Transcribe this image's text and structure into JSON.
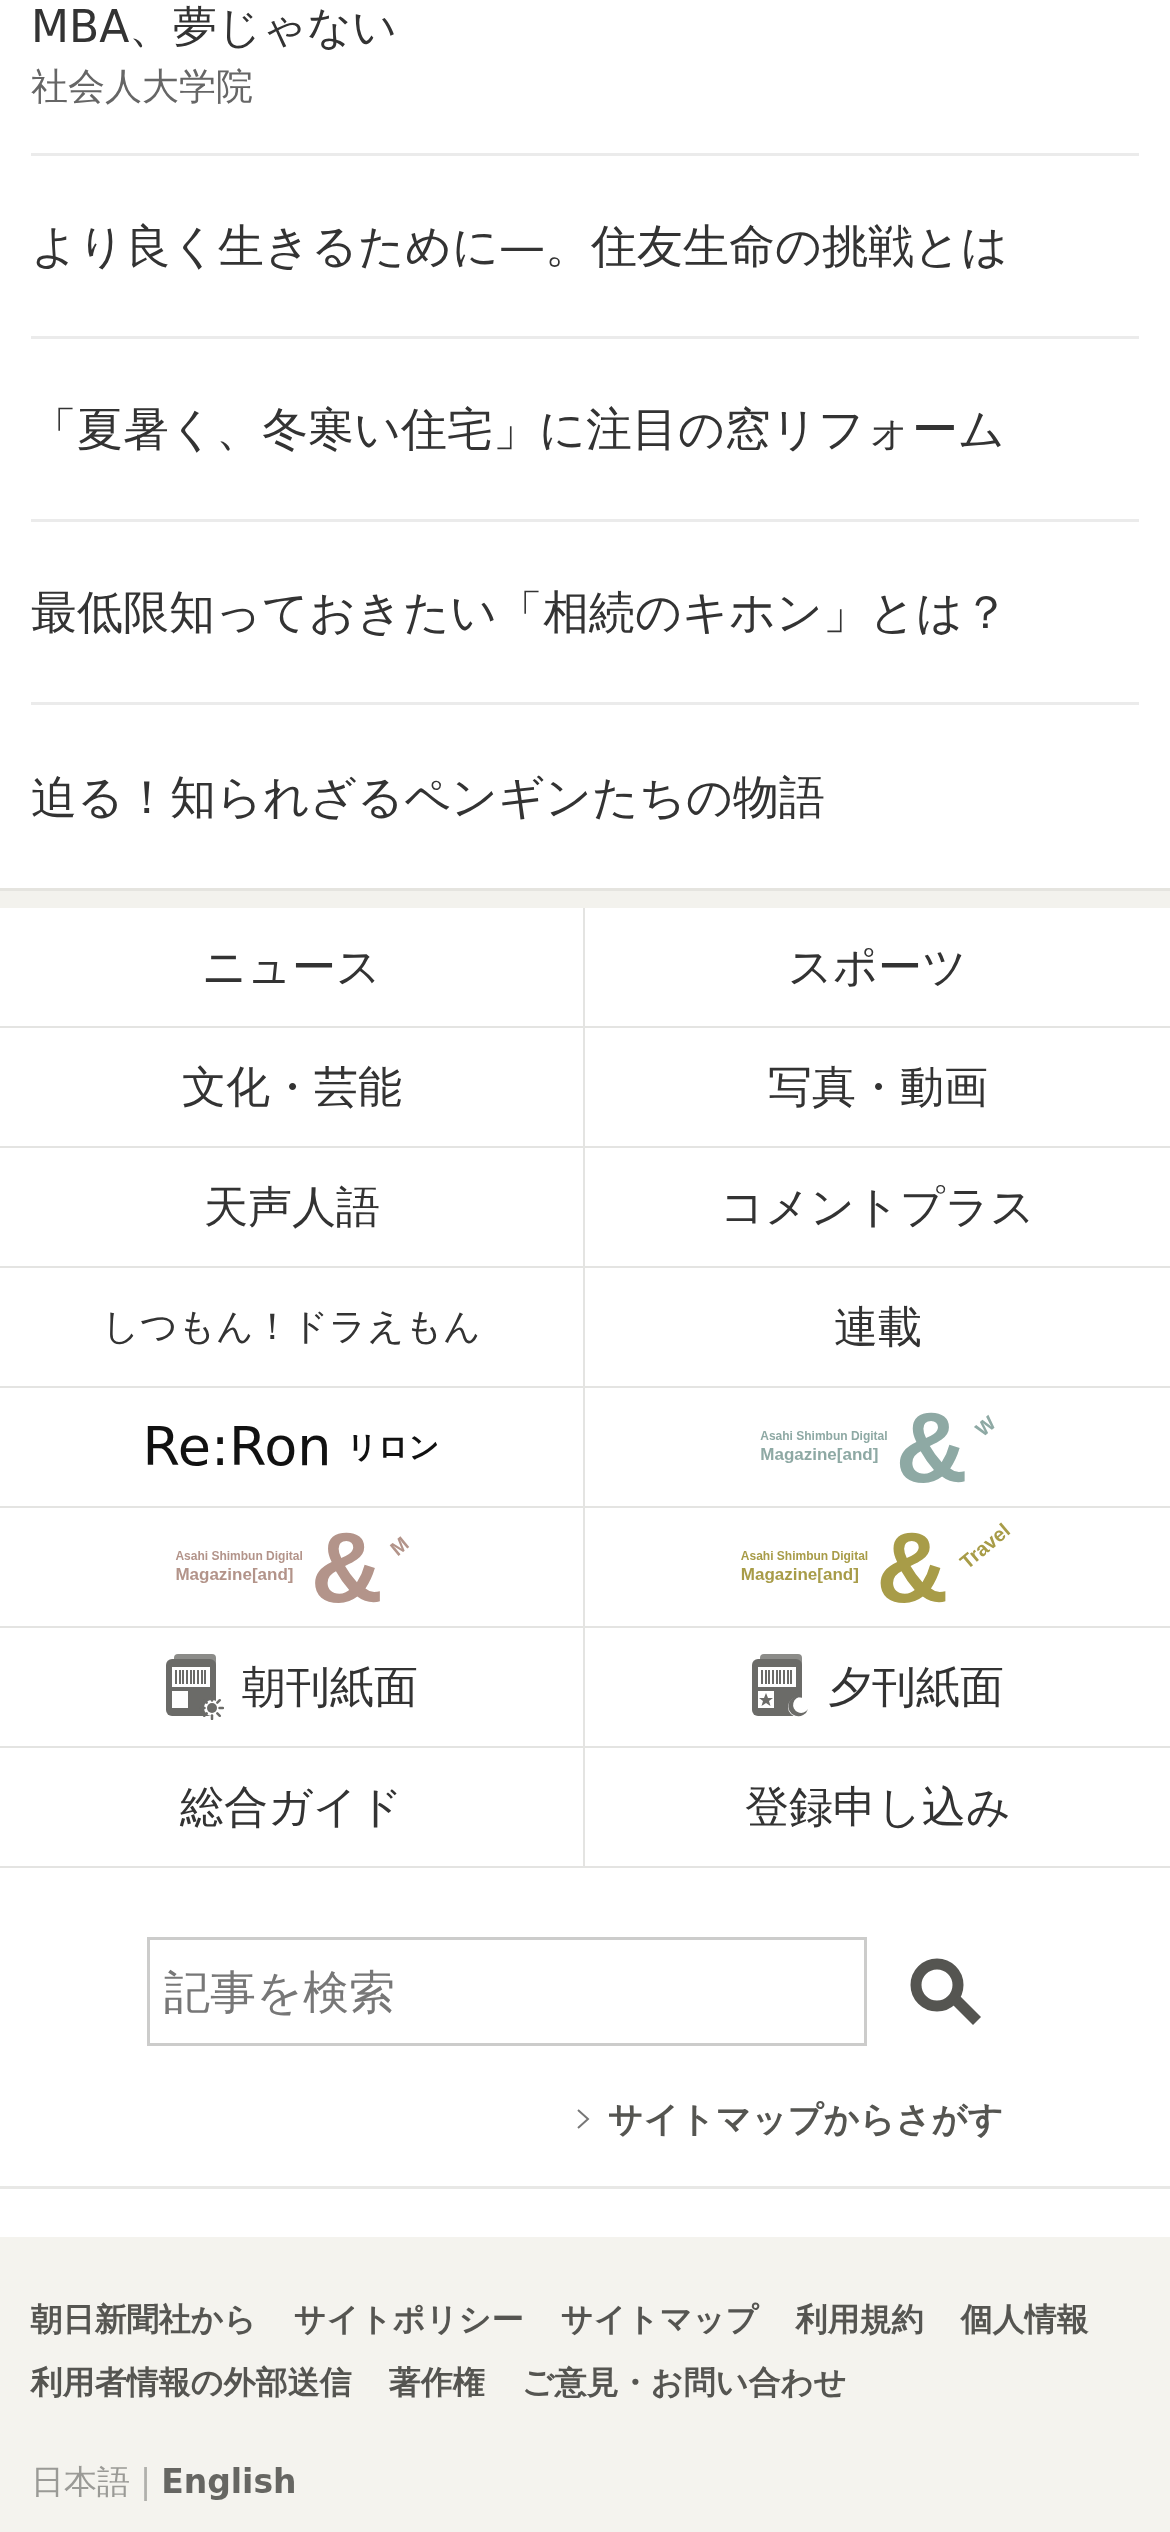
{
  "articles": [
    {
      "title": "MBA、夢じゃない",
      "sponsor": "社会人大学院"
    },
    {
      "title": "より良く生きるために—。住友生命の挑戦とは"
    },
    {
      "title": "「夏暑く、冬寒い住宅」に注目の窓リフォーム"
    },
    {
      "title": "最低限知っておきたい「相続のキホン」とは？"
    },
    {
      "title": "迫る！知られざるペンギンたちの物語"
    }
  ],
  "nav_grid": [
    {
      "kind": "text",
      "label": "ニュース"
    },
    {
      "kind": "text",
      "label": "スポーツ"
    },
    {
      "kind": "text",
      "label": "文化・芸能"
    },
    {
      "kind": "text",
      "label": "写真・動画"
    },
    {
      "kind": "text",
      "label": "天声人語"
    },
    {
      "kind": "text",
      "label": "コメントプラス"
    },
    {
      "kind": "small_text",
      "label": "しつもん！ドラえもん"
    },
    {
      "kind": "text",
      "label": "連載"
    },
    {
      "kind": "wordmark_logo",
      "wordmark": "Re:Ron",
      "kana": "リロン"
    },
    {
      "kind": "magazine_logo",
      "line1": "Asahi Shimbun Digital",
      "line2": "Magazine[and]",
      "mark": "&",
      "suffix": "W",
      "color": "#8ea9a4"
    },
    {
      "kind": "magazine_logo",
      "line1": "Asahi Shimbun Digital",
      "line2": "Magazine[and]",
      "mark": "&",
      "suffix": "M",
      "color": "#b3948a"
    },
    {
      "kind": "magazine_logo",
      "line1": "Asahi Shimbun Digital",
      "line2": "Magazine[and]",
      "mark": "&",
      "suffix": "Travel",
      "color": "#a89c48"
    },
    {
      "kind": "morning_paper",
      "label": "朝刊紙面"
    },
    {
      "kind": "evening_paper",
      "label": "夕刊紙面"
    },
    {
      "kind": "text",
      "label": "総合ガイド"
    },
    {
      "kind": "text",
      "label": "登録申し込み"
    }
  ],
  "search": {
    "placeholder": "記事を検索",
    "sitemap_link": "サイトマップからさがす"
  },
  "footer": {
    "links": [
      "朝日新聞社から",
      "サイトポリシー",
      "サイトマップ",
      "利用規約",
      "個人情報",
      "利用者情報の外部送信",
      "著作権",
      "ご意見・お問い合わせ"
    ],
    "languages": [
      {
        "label": "日本語",
        "selected": true
      },
      {
        "label": "English",
        "selected": false
      }
    ],
    "separator": "|"
  }
}
